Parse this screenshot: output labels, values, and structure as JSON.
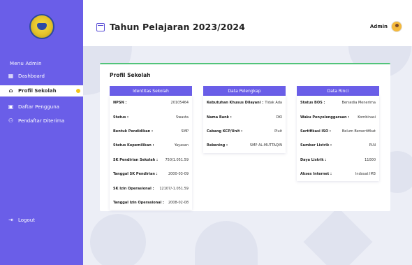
{
  "sidebar": {
    "menu_title": "Menu Admin",
    "items": [
      {
        "label": "Dashboard",
        "icon": "grid-icon"
      },
      {
        "label": "Profil Sekolah",
        "icon": "home-icon"
      },
      {
        "label": "Daftar Pengguna",
        "icon": "clipboard-icon"
      },
      {
        "label": "Pendaftar Diterima",
        "icon": "users-icon"
      }
    ],
    "logout": "Logout"
  },
  "header": {
    "title": "Tahun Pelajaran 2023/2024",
    "user": "Admin"
  },
  "main": {
    "card_title": "Profil Sekolah",
    "identitas": {
      "title": "Identitas Sekolah",
      "rows": [
        {
          "k": "NPSN :",
          "v": "20105464"
        },
        {
          "k": "Status :",
          "v": "Swasta"
        },
        {
          "k": "Bentuk Pendidikan :",
          "v": "SMP"
        },
        {
          "k": "Status Kepemilikan :",
          "v": "Yayasan"
        },
        {
          "k": "SK Pendirian Sekolah :",
          "v": "750/1.051.59"
        },
        {
          "k": "Tanggal SK Pendirian :",
          "v": "2000-03-09"
        },
        {
          "k": "SK Izin Operasional :",
          "v": "12107/-1.051.59"
        },
        {
          "k": "Tanggal Izin Operasional :",
          "v": "2008-02-08"
        }
      ]
    },
    "pelengkap": {
      "title": "Data Pelengkap",
      "rows": [
        {
          "k": "Kebutuhan Khusus Dilayani :",
          "v": "Tidak Ada"
        },
        {
          "k": "Nama Bank :",
          "v": "DKI"
        },
        {
          "k": "Cabang KCP/Unit :",
          "v": "Pluit"
        },
        {
          "k": "Rekening :",
          "v": "SMP AL-MUTTAQIN"
        }
      ]
    },
    "rinci": {
      "title": "Data Rinci",
      "rows": [
        {
          "k": "Status BOS :",
          "v": "Bersedia Menerima"
        },
        {
          "k": "Waku Penyelenggaraan :",
          "v": "Kombinasi"
        },
        {
          "k": "Sertifikasi ISO :",
          "v": "Belum Bersertifikat"
        },
        {
          "k": "Sumber Listrik :",
          "v": "PLN"
        },
        {
          "k": "Daya Listrik :",
          "v": "11000"
        },
        {
          "k": "Akses Internet :",
          "v": "Indosat IM3"
        }
      ]
    }
  },
  "colors": {
    "accent": "#6a5ee8",
    "success_line": "#52c47a",
    "badge": "#f5c518"
  }
}
